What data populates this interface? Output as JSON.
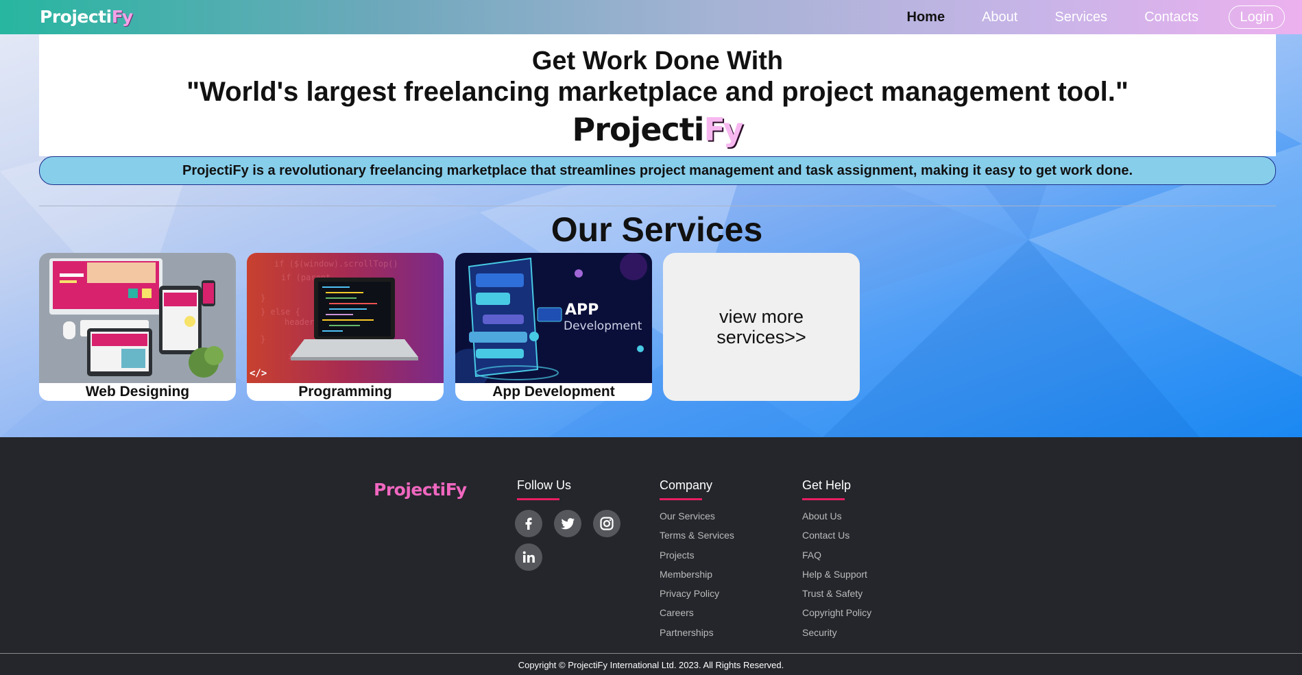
{
  "nav": {
    "logo_main": "Projecti",
    "logo_accent": "Fy",
    "links": [
      "Home",
      "About",
      "Services",
      "Contacts"
    ],
    "login": "Login"
  },
  "hero": {
    "line1": "Get Work Done With",
    "line2": "\"World's largest freelancing marketplace and project management tool.\"",
    "brand_main": "Projecti",
    "brand_accent": "Fy",
    "tagline": "ProjectiFy is a revolutionary freelancing marketplace that streamlines project management and task assignment, making it easy to get work done."
  },
  "services": {
    "title": "Our Services",
    "cards": [
      {
        "label": "Web Designing",
        "image": "web-design-devices-image"
      },
      {
        "label": "Programming",
        "image": "laptop-code-image"
      },
      {
        "label": "App Development",
        "image": "app-development-image"
      }
    ],
    "more": "view more services>>"
  },
  "footer": {
    "logo": "ProjectiFy",
    "follow": {
      "heading": "Follow Us",
      "icons": [
        "facebook-icon",
        "twitter-icon",
        "instagram-icon",
        "linkedin-icon"
      ]
    },
    "company": {
      "heading": "Company",
      "items": [
        "Our Services",
        "Terms & Services",
        "Projects",
        "Membership",
        "Privacy Policy",
        "Careers",
        "Partnerships"
      ]
    },
    "help": {
      "heading": "Get Help",
      "items": [
        "About Us",
        "Contact Us",
        "FAQ",
        "Help & Support",
        "Trust & Safety",
        "Copyright Policy",
        "Security"
      ]
    },
    "copyright": "Copyright © ProjectiFy International Ltd. 2023. All Rights Reserved."
  },
  "colors": {
    "accent_pink": "#e91e63",
    "tagline_bg": "#87ceeb",
    "footer_bg": "#24262b"
  }
}
